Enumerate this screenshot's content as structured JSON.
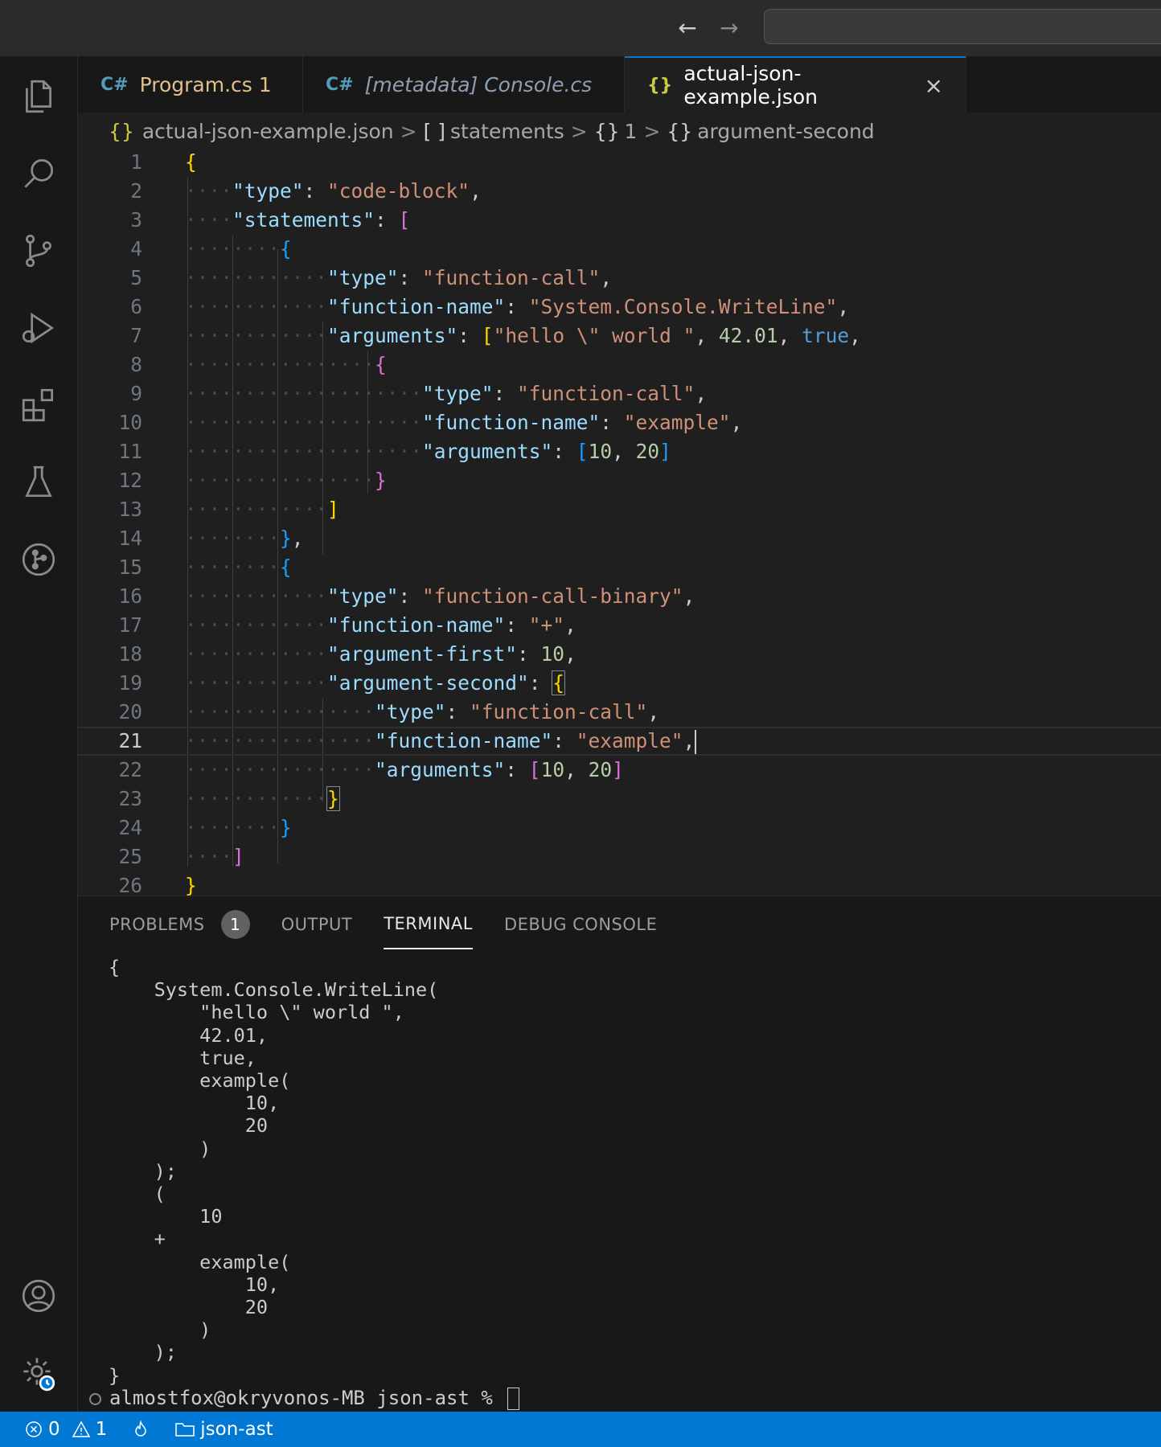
{
  "tabs": [
    {
      "icon": "C#",
      "label": "Program.cs 1"
    },
    {
      "icon": "C#",
      "label": "[metadata] Console.cs"
    },
    {
      "icon": "{}",
      "label": "actual-json-example.json",
      "close": "×"
    }
  ],
  "breadcrumb": {
    "file_icon": "{}",
    "file": "actual-json-example.json",
    "sep": ">",
    "items": [
      {
        "sym": "[ ]",
        "label": "statements"
      },
      {
        "sym": "{}",
        "label": "1"
      },
      {
        "sym": "{}",
        "label": "argument-second"
      }
    ]
  },
  "editor": {
    "line_numbers": [
      "1",
      "2",
      "3",
      "4",
      "5",
      "6",
      "7",
      "8",
      "9",
      "10",
      "11",
      "12",
      "13",
      "14",
      "15",
      "16",
      "17",
      "18",
      "19",
      "20",
      "21",
      "22",
      "23",
      "24",
      "25",
      "26"
    ],
    "current_line": 21
  },
  "panel": {
    "tabs": [
      "PROBLEMS",
      "OUTPUT",
      "TERMINAL",
      "DEBUG CONSOLE"
    ],
    "problems_count": "1",
    "active_tab": "TERMINAL",
    "terminal_output": "{\n    System.Console.WriteLine(\n        \"hello \\\" world \",\n        42.01,\n        true,\n        example(\n            10,\n            20\n        )\n    );\n    (\n        10\n    +\n        example(\n            10,\n            20\n        )\n    );\n}",
    "prompt": "almostfox@okryvonos-MB json-ast % "
  },
  "statusbar": {
    "errors": "0",
    "warnings": "1",
    "folder": "json-ast"
  },
  "colors": {
    "accent": "#0078d4",
    "editor_bg": "#1f1f1f",
    "sidebar_bg": "#181818"
  },
  "icons": {
    "activity": [
      "explorer-icon",
      "search-icon",
      "source-control-icon",
      "run-debug-icon",
      "extensions-icon",
      "testing-icon",
      "git-graph-icon",
      "account-icon",
      "settings-gear-icon"
    ],
    "nav": [
      "arrow-left-icon",
      "arrow-right-icon"
    ]
  }
}
